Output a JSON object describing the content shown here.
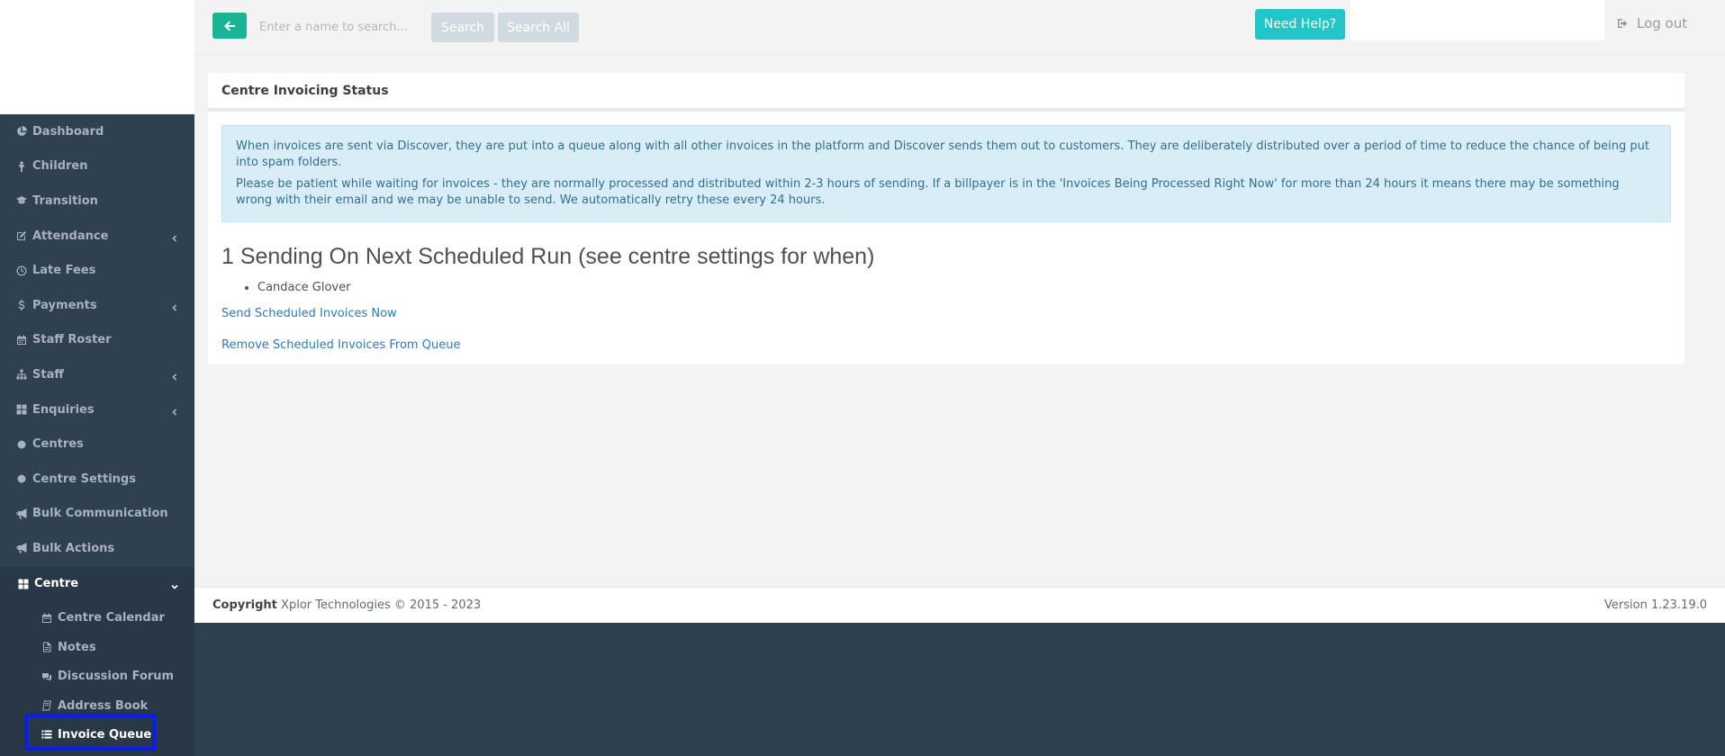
{
  "topbar": {
    "search_placeholder": "Enter a name to search...",
    "search_label": "Search",
    "search_all_label": "Search All",
    "help_label": "Need Help?",
    "logout_label": "Log out"
  },
  "sidebar": {
    "items": [
      {
        "label": "Dashboard",
        "icon": "pie-chart-icon"
      },
      {
        "label": "Children",
        "icon": "child-icon"
      },
      {
        "label": "Transition",
        "icon": "graduation-cap-icon"
      },
      {
        "label": "Attendance",
        "icon": "edit-icon",
        "has_submenu": true
      },
      {
        "label": "Late Fees",
        "icon": "clock-icon"
      },
      {
        "label": "Payments",
        "icon": "dollar-icon",
        "has_submenu": true
      },
      {
        "label": "Staff Roster",
        "icon": "calendar-icon"
      },
      {
        "label": "Staff",
        "icon": "sitemap-icon",
        "has_submenu": true
      },
      {
        "label": "Enquiries",
        "icon": "th-large-icon",
        "has_submenu": true
      },
      {
        "label": "Centres",
        "icon": "circle-icon"
      },
      {
        "label": "Centre Settings",
        "icon": "circle-icon"
      },
      {
        "label": "Bulk Communication",
        "icon": "bullhorn-icon"
      },
      {
        "label": "Bulk Actions",
        "icon": "bullhorn-icon"
      }
    ],
    "active_section": {
      "label": "Centre",
      "icon": "th-large-icon",
      "expanded": true
    },
    "subitems": [
      {
        "label": "Centre Calendar",
        "icon": "calendar-icon"
      },
      {
        "label": "Notes",
        "icon": "file-icon"
      },
      {
        "label": "Discussion Forum",
        "icon": "comments-icon"
      },
      {
        "label": "Address Book",
        "icon": "book-icon"
      },
      {
        "label": "Invoice Queue",
        "icon": "list-icon",
        "current": true
      }
    ]
  },
  "main": {
    "title": "Centre Invoicing Status",
    "alert": {
      "line1": "When invoices are sent via Discover, they are put into a queue along with all other invoices in the platform and Discover sends them out to customers. They are deliberately distributed over a period of time to reduce the chance of being put into spam folders.",
      "line2": "Please be patient while waiting for invoices - they are normally processed and distributed within 2-3 hours of sending. If a billpayer is in the 'Invoices Being Processed Right Now' for more than 24 hours it means there may be something wrong with their email and we may be unable to send. We automatically retry these every 24 hours."
    },
    "section_heading": "1 Sending On Next Scheduled Run (see centre settings for when)",
    "recipients": [
      "Candace Glover"
    ],
    "send_now_label": "Send Scheduled Invoices Now",
    "remove_label": "Remove Scheduled Invoices From Queue"
  },
  "footer": {
    "copyright_bold": "Copyright",
    "copyright_text": "Xplor Technologies © 2015 - 2023",
    "version": "Version 1.23.19.0"
  },
  "colors": {
    "sidebar_bg": "#2f4050",
    "primary": "#1ab394",
    "info": "#23c6c8",
    "alert_bg": "#d9edf7",
    "link": "#337ab7",
    "focus_outline": "#0b1cf5"
  }
}
